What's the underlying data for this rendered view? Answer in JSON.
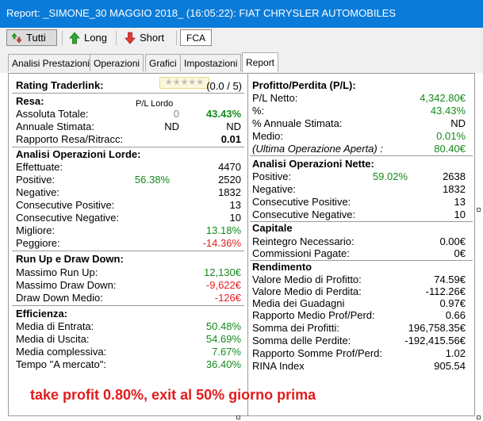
{
  "window": {
    "title": "Report: _SIMONE_30 MAGGIO 2018_ (16:05:22): FIAT CHRYSLER AUTOMOBILES"
  },
  "toolbar": {
    "tutti": "Tutti",
    "long": "Long",
    "short": "Short",
    "symbol": "FCA"
  },
  "tabs": [
    "Analisi Prestazioni",
    "Operazioni",
    "Grafici",
    "Impostazioni",
    "Report"
  ],
  "left": {
    "rating": {
      "label": "Rating Traderlink:",
      "score": "(0.0 / 5)",
      "stars": "★★★★★"
    },
    "resa": {
      "header": "Resa:",
      "col_header": "P/L Lordo",
      "rows": [
        {
          "label": "Assoluta Totale:",
          "v1": "0",
          "v2": "43.43%"
        },
        {
          "label": "Annuale Stimata:",
          "v1": "ND",
          "v2": "ND"
        },
        {
          "label": "Rapporto Resa/Ritracc:",
          "v2": "0.01"
        }
      ]
    },
    "lorde": {
      "header": "Analisi Operazioni Lorde:",
      "rows": [
        {
          "label": "Effettuate:",
          "value": "4470"
        },
        {
          "label": "Positive:",
          "pct": "56.38%",
          "value": "2520"
        },
        {
          "label": "Negative:",
          "value": "1832"
        },
        {
          "label": "Consecutive Positive:",
          "value": "13"
        },
        {
          "label": "Consecutive Negative:",
          "value": "10"
        },
        {
          "label": "Migliore:",
          "value": "13.18%"
        },
        {
          "label": "Peggiore:",
          "value": "-14.36%"
        }
      ]
    },
    "runup": {
      "header": "Run Up e Draw Down:",
      "rows": [
        {
          "label": "Massimo Run Up:",
          "value": "12,130€"
        },
        {
          "label": "Massimo Draw Down:",
          "value": "-9,622€"
        },
        {
          "label": "Draw Down Medio:",
          "value": "-126€"
        }
      ]
    },
    "efficienza": {
      "header": "Efficienza:",
      "rows": [
        {
          "label": "Media di Entrata:",
          "value": "50.48%"
        },
        {
          "label": "Media di Uscita:",
          "value": "54.69%"
        },
        {
          "label": "Media complessiva:",
          "value": "7.67%"
        },
        {
          "label": "Tempo \"A mercato\":",
          "value": "36.40%"
        }
      ]
    }
  },
  "right": {
    "pl": {
      "header": "Profitto/Perdita (P/L):",
      "rows": [
        {
          "label": "P/L Netto:",
          "value": "4,342.80€"
        },
        {
          "label": "%:",
          "value": "43.43%"
        },
        {
          "label": "% Annuale Stimata:",
          "value": "ND"
        },
        {
          "label": "Medio:",
          "value": "0.01%"
        },
        {
          "label": "(Ultima Operazione Aperta) :",
          "value": "80.40€"
        }
      ]
    },
    "nette": {
      "header": "Analisi Operazioni Nette:",
      "rows": [
        {
          "label": "Positive:",
          "pct": "59.02%",
          "value": "2638"
        },
        {
          "label": "Negative:",
          "value": "1832"
        },
        {
          "label": "Consecutive Positive:",
          "value": "13"
        },
        {
          "label": "Consecutive Negative:",
          "value": "10"
        }
      ]
    },
    "capitale": {
      "header": "Capitale",
      "rows": [
        {
          "label": "Reintegro Necessario:",
          "value": "0.00€"
        },
        {
          "label": "Commissioni Pagate:",
          "value": "0€"
        }
      ]
    },
    "rendimento": {
      "header": "Rendimento",
      "rows": [
        {
          "label": "Valore Medio di Profitto:",
          "value": "74.59€"
        },
        {
          "label": "Valore Medio di Perdita:",
          "value": "-112.26€"
        },
        {
          "label": "Media dei Guadagni",
          "value": "0.97€"
        },
        {
          "label": "Rapporto Medio Prof/Perd:",
          "value": "0.66"
        },
        {
          "label": "Somma dei Profitti:",
          "value": "196,758.35€"
        },
        {
          "label": "Somma delle Perdite:",
          "value": "-192,415.56€"
        },
        {
          "label": "Rapporto Somme Prof/Perd:",
          "value": "1.02"
        },
        {
          "label": "RINA Index",
          "value": "905.54"
        }
      ]
    }
  },
  "annotation": "take profit 0.80%, exit al 50% giorno prima",
  "colors": {
    "positive": "#128c1a",
    "negative": "#e21c1c",
    "titlebar": "#0a7bd8"
  }
}
